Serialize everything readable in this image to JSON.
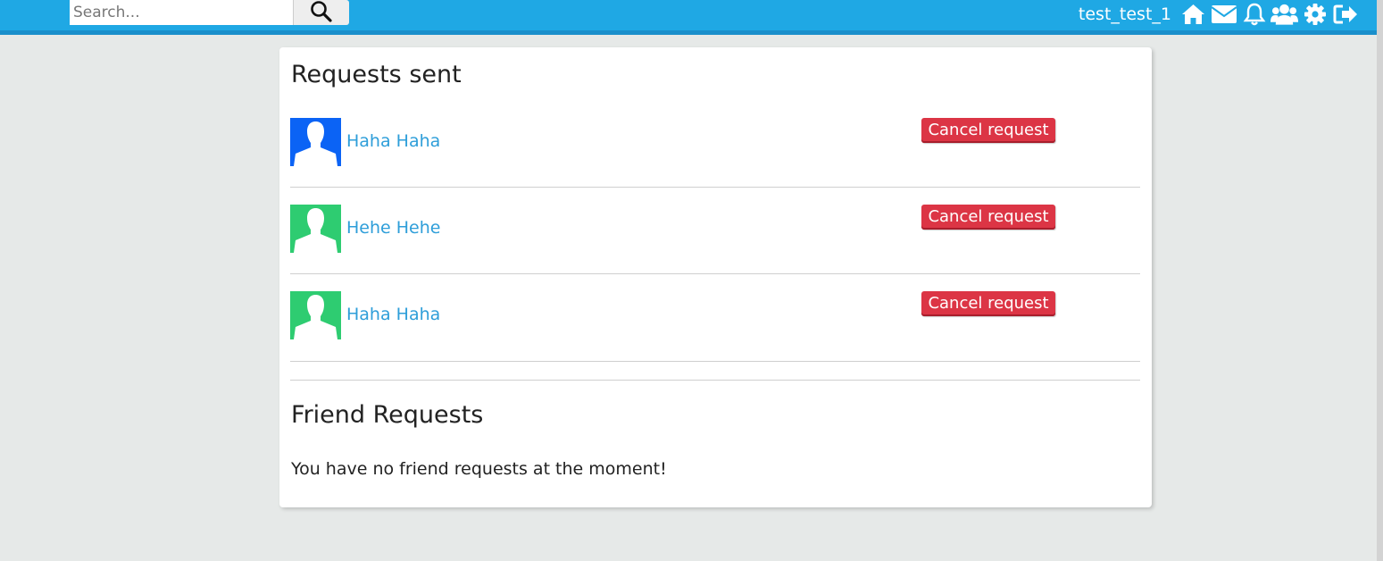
{
  "navbar": {
    "search": {
      "placeholder": "Search...",
      "value": ""
    },
    "username": "test_test_1",
    "icons": [
      "search-icon",
      "home-icon",
      "envelope-icon",
      "bell-icon",
      "users-icon",
      "gear-icon",
      "sign-out-icon"
    ],
    "colors": {
      "bar": "#1fa8e4",
      "bar_border": "#1a8fcb"
    }
  },
  "requests_sent": {
    "title": "Requests sent",
    "items": [
      {
        "name": "Haha Haha",
        "button_label": "Cancel request",
        "avatar_color": "#0b63f5"
      },
      {
        "name": "Hehe Hehe",
        "button_label": "Cancel request",
        "avatar_color": "#2ecc71"
      },
      {
        "name": "Haha Haha",
        "button_label": "Cancel request",
        "avatar_color": "#2ecc71"
      }
    ]
  },
  "friend_requests": {
    "title": "Friend Requests",
    "empty_message": "You have no friend requests at the moment!"
  },
  "colors": {
    "background": "#e6e9e8",
    "link": "#2e9ed9",
    "danger": "#dc3545"
  }
}
